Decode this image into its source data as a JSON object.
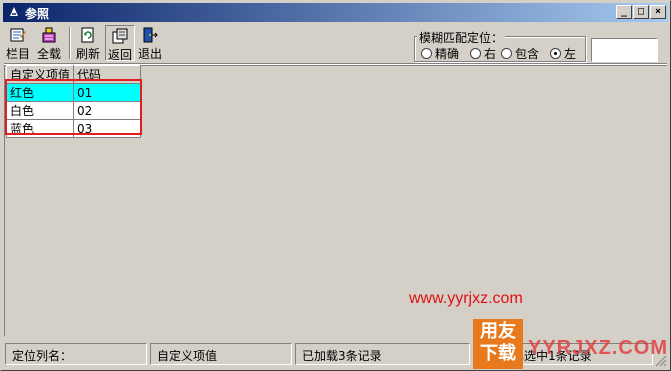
{
  "window": {
    "title": "参照",
    "controls": {
      "minimize": "_",
      "maximize": "□",
      "close": "×"
    }
  },
  "toolbar": {
    "columns_label": "栏目",
    "load_all_label": "全载",
    "refresh_label": "刷新",
    "back_label": "返回",
    "exit_label": "退出"
  },
  "fuzzy_match": {
    "title": "模糊匹配定位：",
    "options": [
      {
        "label": "精确",
        "selected": false
      },
      {
        "label": "右",
        "selected": false
      },
      {
        "label": "包含",
        "selected": false
      },
      {
        "label": "左",
        "selected": true
      }
    ],
    "input_value": ""
  },
  "grid": {
    "columns": [
      "自定义项值",
      "代码"
    ],
    "rows": [
      {
        "name": "红色",
        "code": "01",
        "selected": true
      },
      {
        "name": "白色",
        "code": "02",
        "selected": false
      },
      {
        "name": "蓝色",
        "code": "03",
        "selected": false
      }
    ]
  },
  "watermark": {
    "url": "www.yyrjxz.com",
    "logo_line1": "用友",
    "logo_line2": "下载",
    "logo_site": "YYRJXZ.COM"
  },
  "statusbar": {
    "locate_column_label": "定位列名：",
    "locate_column_value": "自定义项值",
    "loaded_text": "已加载3条记录",
    "selected_text": "已选中1条记录"
  },
  "colors": {
    "title_gradient_start": "#0a246a",
    "title_gradient_end": "#a6caf0",
    "selected_row": "#00ffff",
    "highlight_border": "#e02020",
    "watermark_red": "#e01010",
    "logo_orange": "#e87a1d"
  },
  "icons": {
    "title": "app-icon",
    "columns": "columns-icon",
    "load_all": "load-all-icon",
    "refresh": "refresh-icon",
    "back": "back-icon",
    "exit": "exit-icon"
  }
}
